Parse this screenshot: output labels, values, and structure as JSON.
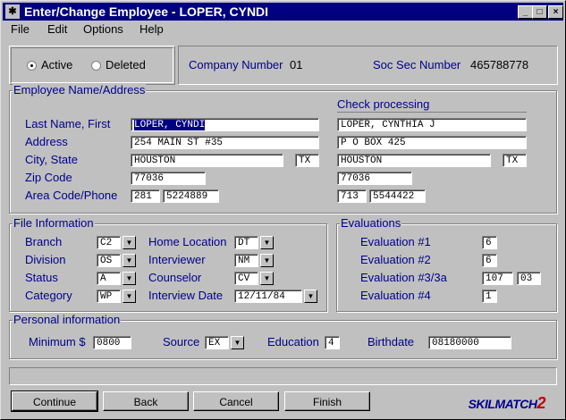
{
  "window": {
    "title": "Enter/Change Employee - LOPER, CYNDI",
    "app_icon": "gear-app-icon",
    "minimize": "_",
    "maximize": "□",
    "close": "×"
  },
  "menu": [
    "File",
    "Edit",
    "Options",
    "Help"
  ],
  "status": {
    "active_label": "Active",
    "deleted_label": "Deleted",
    "selected": "Active"
  },
  "company": {
    "label": "Company Number",
    "value": "01"
  },
  "ssn": {
    "label": "Soc Sec Number",
    "value": "465788778"
  },
  "name_address": {
    "title": "Employee Name/Address",
    "check_title": "Check processing",
    "last_first_label": "Last Name, First",
    "address_label": "Address",
    "city_state_label": "City, State",
    "zip_label": "Zip Code",
    "phone_label": "Area Code/Phone",
    "name": "LOPER, CYNDI",
    "address": "254 MAIN ST #35",
    "city": "HOUSTON",
    "state": "TX",
    "zip": "77036",
    "area_code": "281",
    "phone": "5224889",
    "check_name": "LOPER, CYNTHIA J",
    "check_address": "P O BOX 425",
    "check_city": "HOUSTON",
    "check_state": "TX",
    "check_zip": "77036",
    "check_area_code": "713",
    "check_phone": "5544422"
  },
  "file_info": {
    "title": "File Information",
    "branch_label": "Branch",
    "branch": "C2",
    "division_label": "Division",
    "division": "OS",
    "status_label": "Status",
    "status": "A",
    "category_label": "Category",
    "category": "WP",
    "home_location_label": "Home Location",
    "home_location": "DT",
    "interviewer_label": "Interviewer",
    "interviewer": "NM",
    "counselor_label": "Counselor",
    "counselor": "CV",
    "interview_date_label": "Interview Date",
    "interview_date": "12/11/84"
  },
  "evaluations": {
    "title": "Evaluations",
    "e1_label": "Evaluation #1",
    "e1": "6",
    "e2_label": "Evaluation #2",
    "e2": "6",
    "e3_label": "Evaluation #3/3a",
    "e3": "107",
    "e3a": "03",
    "e4_label": "Evaluation #4",
    "e4": "1"
  },
  "personal": {
    "title": "Personal information",
    "minimum_label": "Minimum $",
    "minimum": "0800",
    "source_label": "Source",
    "source": "EX",
    "education_label": "Education",
    "education": "4",
    "birthdate_label": "Birthdate",
    "birthdate": "08180000"
  },
  "buttons": {
    "continue": "Continue",
    "back": "Back",
    "cancel": "Cancel",
    "finish": "Finish"
  },
  "logo": {
    "text": "SKILMATCH",
    "number": "2"
  }
}
